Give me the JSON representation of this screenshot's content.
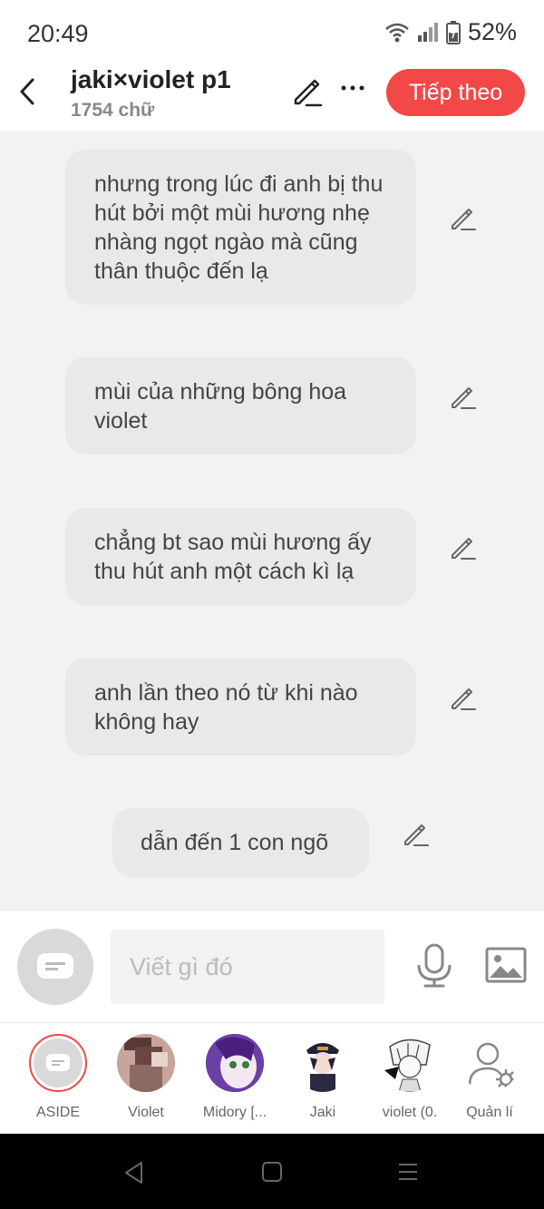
{
  "status": {
    "time": "20:49",
    "battery": "52%"
  },
  "header": {
    "title": "jaki×violet p1",
    "word_count": "1754 chữ",
    "next_label": "Tiếp theo",
    "next_color": "#f24848"
  },
  "messages": [
    {
      "text": "nhưng trong lúc đi anh bị thu hút bởi một mùi hương nhẹ nhàng ngọt ngào mà cũng thân thuộc đến lạ"
    },
    {
      "text": "mùi của những bông hoa violet"
    },
    {
      "text": "chẳng bt sao mùi hương ấy thu hút anh một cách kì lạ"
    },
    {
      "text": "anh lần theo nó từ khi nào không hay"
    },
    {
      "text": "dẫn đến 1 con ngõ"
    }
  ],
  "composer": {
    "placeholder": "Viết gì đó"
  },
  "characters": [
    {
      "name": "ASIDE"
    },
    {
      "name": "Violet"
    },
    {
      "name": "Midory [..."
    },
    {
      "name": "Jaki"
    },
    {
      "name": "violet (0."
    },
    {
      "name": "Quản lí"
    }
  ]
}
